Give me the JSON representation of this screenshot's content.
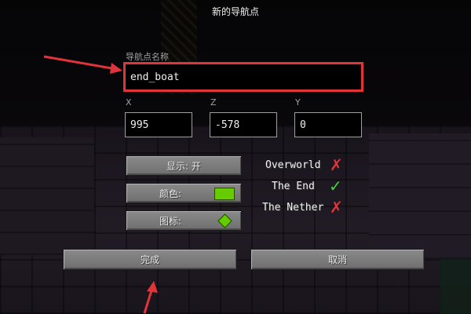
{
  "screen_title": "新的导航点",
  "name_field": {
    "label": "导航点名称",
    "value": "end_boat"
  },
  "coords": [
    {
      "label": "X",
      "value": "995"
    },
    {
      "label": "Z",
      "value": "-578"
    },
    {
      "label": "Y",
      "value": "0"
    }
  ],
  "buttons": {
    "visibility": "显示:  开",
    "color": "颜色:",
    "icon": "图标:",
    "done": "完成",
    "cancel": "取消"
  },
  "dimensions": [
    {
      "name": "Overworld",
      "state": "✗",
      "enabled": false
    },
    {
      "name": "The End",
      "state": "✓",
      "enabled": true
    },
    {
      "name": "The Nether",
      "state": "✗",
      "enabled": false
    }
  ],
  "colors": {
    "waypoint": "#66cc00",
    "check": "#3fd43f",
    "cross": "#e0343a",
    "highlight": "#e0343a"
  }
}
